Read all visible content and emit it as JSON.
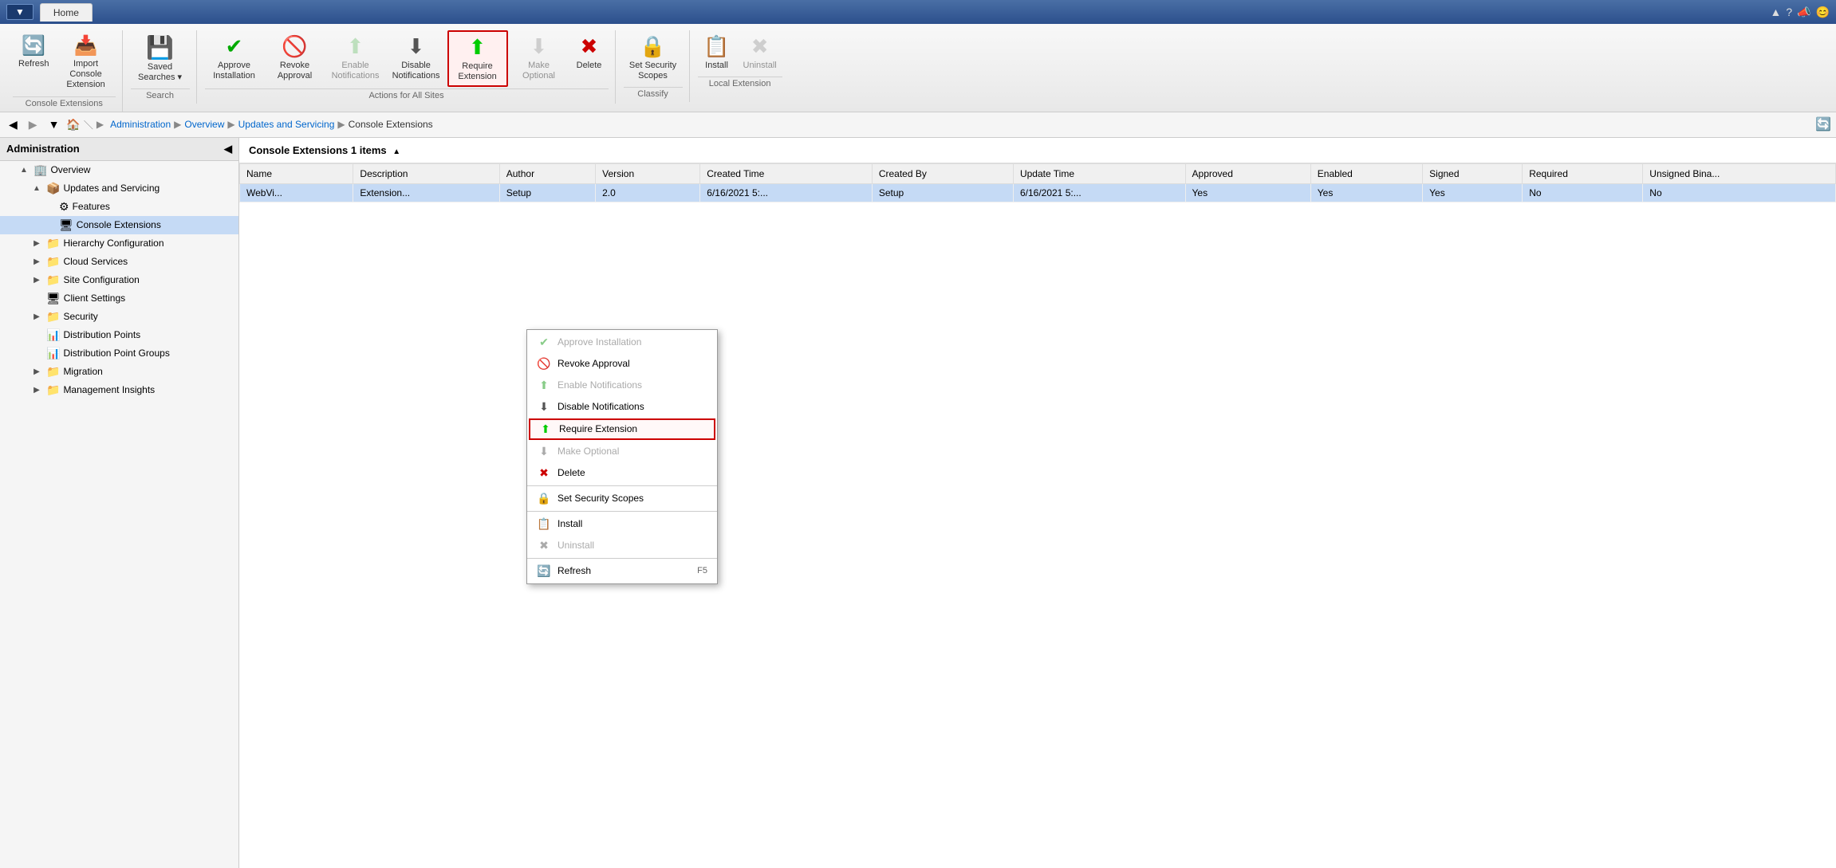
{
  "titleBar": {
    "appBtn": "▼",
    "homeTab": "Home",
    "icons": [
      "▲",
      "?",
      "📣",
      "😊"
    ]
  },
  "ribbon": {
    "groups": [
      {
        "label": "Console Extensions",
        "buttons": [
          {
            "id": "refresh",
            "icon": "🔄",
            "label": "Refresh",
            "disabled": false,
            "highlighted": false
          },
          {
            "id": "import-console-ext",
            "icon": "📥",
            "label": "Import Console Extension",
            "disabled": false,
            "highlighted": false
          }
        ]
      },
      {
        "label": "Search",
        "buttons": [
          {
            "id": "saved-searches",
            "icon": "💾",
            "label": "Saved Searches ▾",
            "disabled": false,
            "highlighted": false
          }
        ]
      },
      {
        "label": "Actions for All Sites",
        "buttons": [
          {
            "id": "approve-installation",
            "icon": "✔",
            "label": "Approve Installation",
            "disabled": false,
            "highlighted": false,
            "iconColor": "#00aa00"
          },
          {
            "id": "revoke-approval",
            "icon": "🚫",
            "label": "Revoke Approval",
            "disabled": false,
            "highlighted": false
          },
          {
            "id": "enable-notifications",
            "icon": "⬆",
            "label": "Enable Notifications",
            "disabled": false,
            "highlighted": false,
            "iconColor": "#88cc88"
          },
          {
            "id": "disable-notifications",
            "icon": "⬇",
            "label": "Disable Notifications",
            "disabled": false,
            "highlighted": false,
            "iconColor": "#555"
          },
          {
            "id": "require-extension",
            "icon": "⬆",
            "label": "Require Extension",
            "disabled": false,
            "highlighted": true,
            "iconColor": "#00cc00"
          },
          {
            "id": "make-optional",
            "icon": "⬇",
            "label": "Make Optional",
            "disabled": false,
            "highlighted": false,
            "iconColor": "#aaa"
          },
          {
            "id": "delete",
            "icon": "✖",
            "label": "Delete",
            "disabled": false,
            "highlighted": false,
            "iconColor": "#cc0000"
          }
        ]
      },
      {
        "label": "Classify",
        "buttons": [
          {
            "id": "set-security-scopes",
            "icon": "🔒",
            "label": "Set Security Scopes",
            "disabled": false,
            "highlighted": false
          }
        ]
      },
      {
        "label": "Local Extension",
        "buttons": [
          {
            "id": "install",
            "icon": "📋",
            "label": "Install",
            "disabled": false,
            "highlighted": false
          },
          {
            "id": "uninstall",
            "icon": "✖",
            "label": "Uninstall",
            "disabled": false,
            "highlighted": false,
            "iconColor": "#aaa"
          }
        ]
      }
    ]
  },
  "navBar": {
    "backDisabled": false,
    "forwardDisabled": true,
    "breadcrumb": [
      "Administration",
      "Overview",
      "Updates and Servicing",
      "Console Extensions"
    ]
  },
  "sidebar": {
    "title": "Administration",
    "items": [
      {
        "id": "overview",
        "label": "Overview",
        "indent": 1,
        "expander": "▲",
        "icon": "🏢",
        "selected": false
      },
      {
        "id": "updates-servicing",
        "label": "Updates and Servicing",
        "indent": 2,
        "expander": "▲",
        "icon": "📦",
        "selected": false
      },
      {
        "id": "features",
        "label": "Features",
        "indent": 3,
        "expander": "",
        "icon": "⚙",
        "selected": false
      },
      {
        "id": "console-extensions",
        "label": "Console Extensions",
        "indent": 3,
        "expander": "",
        "icon": "🖥",
        "selected": true
      },
      {
        "id": "hierarchy-config",
        "label": "Hierarchy Configuration",
        "indent": 2,
        "expander": "▶",
        "icon": "📁",
        "selected": false
      },
      {
        "id": "cloud-services",
        "label": "Cloud Services",
        "indent": 2,
        "expander": "▶",
        "icon": "📁",
        "selected": false
      },
      {
        "id": "site-configuration",
        "label": "Site Configuration",
        "indent": 2,
        "expander": "▶",
        "icon": "📁",
        "selected": false
      },
      {
        "id": "client-settings",
        "label": "Client Settings",
        "indent": 2,
        "expander": "",
        "icon": "🖥",
        "selected": false
      },
      {
        "id": "security",
        "label": "Security",
        "indent": 2,
        "expander": "▶",
        "icon": "📁",
        "selected": false
      },
      {
        "id": "distribution-points",
        "label": "Distribution Points",
        "indent": 2,
        "expander": "",
        "icon": "📊",
        "selected": false
      },
      {
        "id": "distribution-point-groups",
        "label": "Distribution Point Groups",
        "indent": 2,
        "expander": "",
        "icon": "📊",
        "selected": false
      },
      {
        "id": "migration",
        "label": "Migration",
        "indent": 2,
        "expander": "▶",
        "icon": "📁",
        "selected": false
      },
      {
        "id": "management-insights",
        "label": "Management Insights",
        "indent": 2,
        "expander": "▶",
        "icon": "📁",
        "selected": false
      }
    ]
  },
  "content": {
    "title": "Console Extensions 1 items",
    "columns": [
      "Name",
      "Description",
      "Author",
      "Version",
      "Created Time",
      "Created By",
      "Update Time",
      "Approved",
      "Enabled",
      "Signed",
      "Required",
      "Unsigned Bina..."
    ],
    "rows": [
      {
        "name": "WebVi...",
        "description": "Extension...",
        "author": "Setup",
        "version": "2.0",
        "createdTime": "6/16/2021 5:...",
        "createdBy": "Setup",
        "updateTime": "6/16/2021 5:...",
        "approved": "Yes",
        "enabled": "Yes",
        "signed": "Yes",
        "required": "No",
        "unsignedBinary": "No"
      }
    ]
  },
  "contextMenu": {
    "items": [
      {
        "id": "approve-installation",
        "label": "Approve Installation",
        "icon": "✔",
        "iconColor": "#88cc88",
        "disabled": true,
        "separator": false,
        "shortcut": ""
      },
      {
        "id": "revoke-approval",
        "label": "Revoke Approval",
        "icon": "🚫",
        "iconColor": "#cc0000",
        "disabled": false,
        "separator": false,
        "shortcut": ""
      },
      {
        "id": "enable-notifications",
        "label": "Enable Notifications",
        "icon": "⬆",
        "iconColor": "#88cc88",
        "disabled": true,
        "separator": false,
        "shortcut": ""
      },
      {
        "id": "disable-notifications",
        "label": "Disable Notifications",
        "icon": "⬇",
        "iconColor": "#555",
        "disabled": false,
        "separator": false,
        "shortcut": ""
      },
      {
        "id": "require-extension",
        "label": "Require Extension",
        "icon": "⬆",
        "iconColor": "#00cc00",
        "disabled": false,
        "separator": false,
        "shortcut": "",
        "highlighted": true
      },
      {
        "id": "make-optional",
        "label": "Make Optional",
        "icon": "⬇",
        "iconColor": "#aaa",
        "disabled": true,
        "separator": false,
        "shortcut": ""
      },
      {
        "id": "delete",
        "label": "Delete",
        "icon": "✖",
        "iconColor": "#cc0000",
        "disabled": false,
        "separator": false,
        "shortcut": ""
      },
      {
        "id": "sep1",
        "separator": true
      },
      {
        "id": "set-security-scopes",
        "label": "Set Security Scopes",
        "icon": "🔒",
        "iconColor": "#555",
        "disabled": false,
        "separator": false,
        "shortcut": ""
      },
      {
        "id": "sep2",
        "separator": true
      },
      {
        "id": "install",
        "label": "Install",
        "icon": "📋",
        "iconColor": "#555",
        "disabled": false,
        "separator": false,
        "shortcut": ""
      },
      {
        "id": "uninstall",
        "label": "Uninstall",
        "icon": "✖",
        "iconColor": "#aaa",
        "disabled": true,
        "separator": false,
        "shortcut": ""
      },
      {
        "id": "sep3",
        "separator": true
      },
      {
        "id": "refresh",
        "label": "Refresh",
        "icon": "🔄",
        "iconColor": "#00aa44",
        "disabled": false,
        "separator": false,
        "shortcut": "F5"
      }
    ]
  }
}
